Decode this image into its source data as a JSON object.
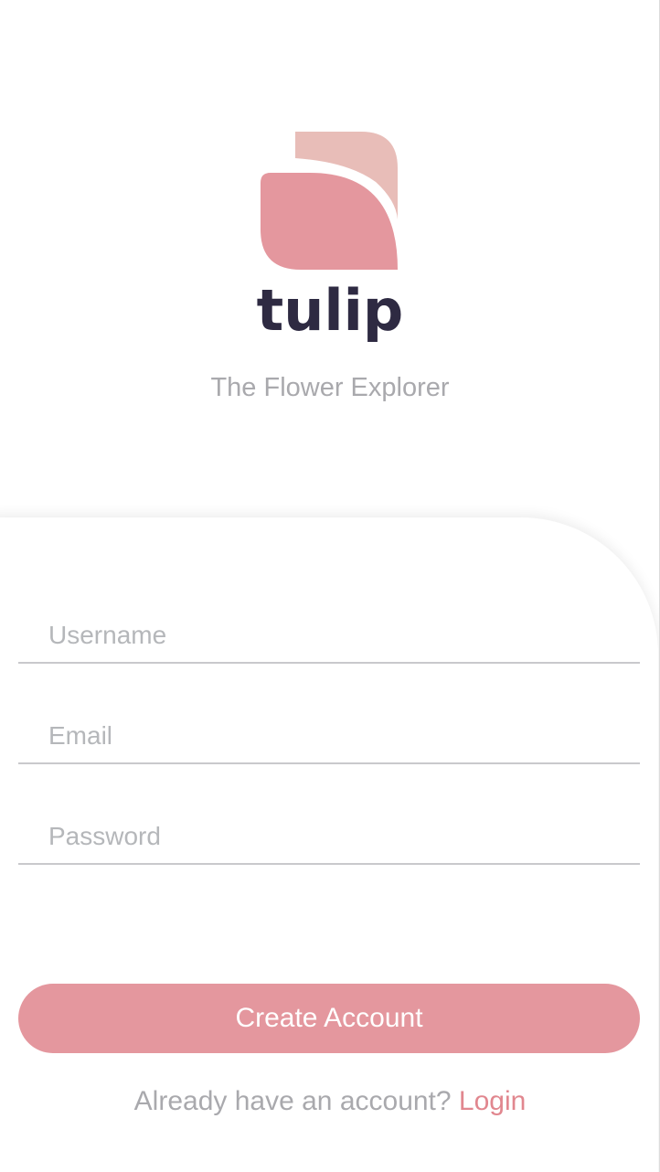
{
  "brand": {
    "name": "tulip",
    "tagline": "The Flower Explorer",
    "logo_icon": "tulip-petals-icon",
    "colors": {
      "petal_front": "#e4979e",
      "petal_back": "#e8bdb8",
      "text_dark": "#2e2a42"
    }
  },
  "form": {
    "username_placeholder": "Username",
    "email_placeholder": "Email",
    "password_placeholder": "Password",
    "submit_label": "Create Account"
  },
  "footer": {
    "prompt": "Already have an account?",
    "login_label": "Login"
  },
  "theme": {
    "accent": "#e4979e",
    "muted_text": "#a9a9ad"
  }
}
